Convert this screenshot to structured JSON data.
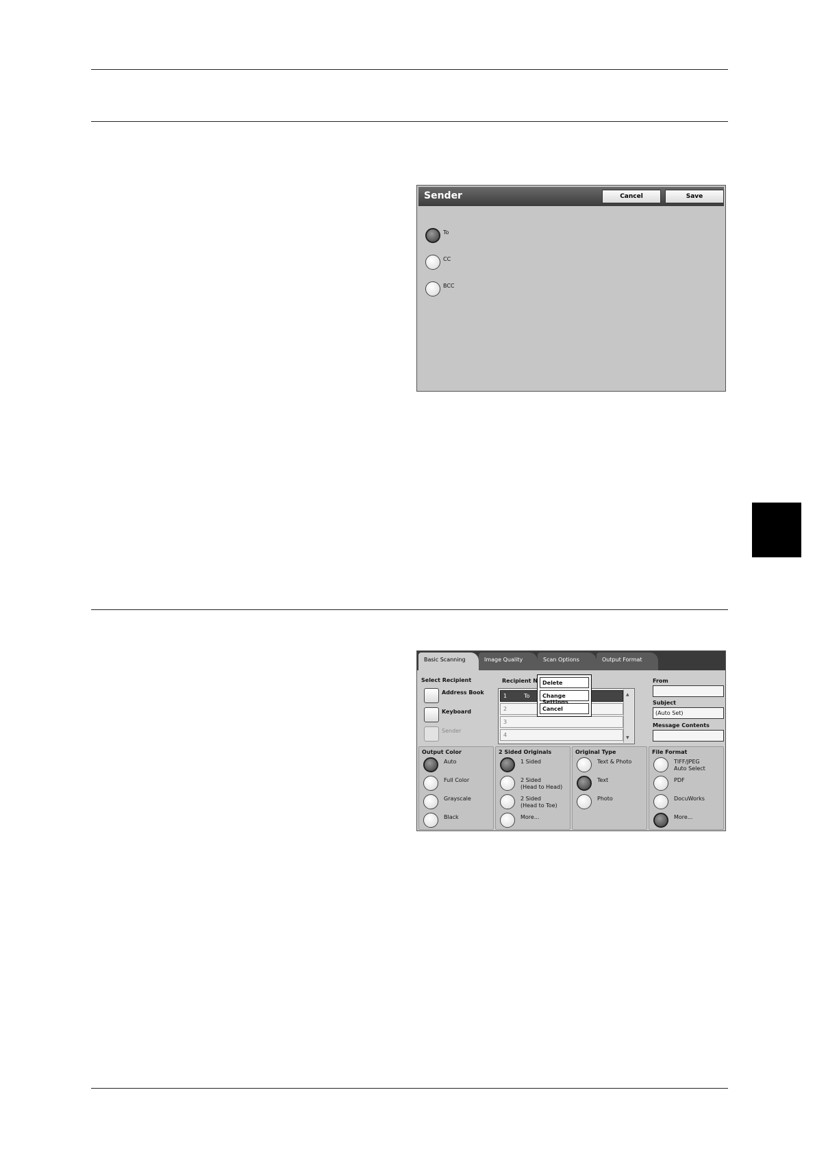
{
  "sender_dialog": {
    "title": "Sender",
    "cancel_label": "Cancel",
    "save_label": "Save",
    "options": [
      {
        "label": "To",
        "selected": true
      },
      {
        "label": "CC",
        "selected": false
      },
      {
        "label": "BCC",
        "selected": false
      }
    ]
  },
  "scan_screen": {
    "tabs": [
      "Basic Scanning",
      "Image Quality",
      "Scan Options",
      "Output Format"
    ],
    "select_recipient": {
      "heading": "Select Recipient",
      "address_book": "Address Book",
      "keyboard": "Keyboard",
      "sender": "Sender"
    },
    "recipient_list": {
      "heading": "Recipient Nam",
      "rows": [
        {
          "num": "1",
          "type": "To"
        },
        {
          "num": "2",
          "type": ""
        },
        {
          "num": "3",
          "type": ""
        },
        {
          "num": "4",
          "type": ""
        }
      ]
    },
    "popup_menu": [
      "Delete",
      "Change Settings",
      "Cancel"
    ],
    "from": {
      "label": "From",
      "value": ""
    },
    "subject": {
      "label": "Subject",
      "value": "(Auto Set)"
    },
    "message": {
      "label": "Message Contents",
      "value": ""
    },
    "output_color": {
      "heading": "Output Color",
      "options": [
        {
          "label": "Auto",
          "selected": true
        },
        {
          "label": "Full Color",
          "selected": false
        },
        {
          "label": "Grayscale",
          "selected": false
        },
        {
          "label": "Black",
          "selected": false
        }
      ]
    },
    "two_sided": {
      "heading": "2 Sided Originals",
      "options": [
        {
          "label": "1 Sided",
          "sub": "",
          "selected": true
        },
        {
          "label": "2 Sided",
          "sub": "(Head to Head)",
          "selected": false
        },
        {
          "label": "2 Sided",
          "sub": "(Head to Toe)",
          "selected": false
        },
        {
          "label": "More...",
          "sub": "",
          "selected": false
        }
      ]
    },
    "original_type": {
      "heading": "Original Type",
      "options": [
        {
          "label": "Text & Photo",
          "selected": false
        },
        {
          "label": "Text",
          "selected": true
        },
        {
          "label": "Photo",
          "selected": false
        }
      ]
    },
    "file_format": {
      "heading": "File Format",
      "options": [
        {
          "label": "TIFF/JPEG",
          "sub": "Auto Select",
          "selected": false
        },
        {
          "label": "PDF",
          "sub": "",
          "selected": false
        },
        {
          "label": "DocuWorks",
          "sub": "",
          "selected": false
        },
        {
          "label": "More...",
          "sub": "",
          "selected": true
        }
      ]
    }
  }
}
